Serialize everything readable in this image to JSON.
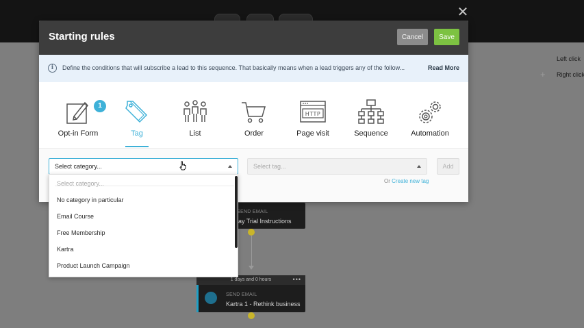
{
  "background": {
    "close_symbol": "✕",
    "right_panel": {
      "left_click": "Left click",
      "right_click": "Right click"
    },
    "flow_card_1": {
      "type_label": "SEND EMAIL",
      "title": "lay Trial Instructions"
    },
    "flow_card_2": {
      "header": "1 days and 0 hours",
      "type_label": "SEND EMAIL",
      "title": "Kartra 1 - Rethink business"
    }
  },
  "modal": {
    "title": "Starting rules",
    "cancel_label": "Cancel",
    "save_label": "Save",
    "info": {
      "text": "Define the conditions that will subscribe a lead to this sequence. That basically means when a lead triggers any of the follow...",
      "read_more": "Read More"
    },
    "triggers": [
      {
        "label": "Opt-in Form",
        "icon": "opt-in-form-icon",
        "badge": "1"
      },
      {
        "label": "Tag",
        "icon": "tag-icon",
        "active": true
      },
      {
        "label": "List",
        "icon": "list-people-icon"
      },
      {
        "label": "Order",
        "icon": "cart-icon"
      },
      {
        "label": "Page visit",
        "icon": "http-page-icon"
      },
      {
        "label": "Sequence",
        "icon": "sequence-tree-icon"
      },
      {
        "label": "Automation",
        "icon": "gears-icon"
      }
    ],
    "controls": {
      "category_value": "Select category...",
      "tag_placeholder": "Select tag...",
      "add_label": "Add",
      "create_prefix": "Or",
      "create_link": "Create new tag"
    }
  },
  "dropdown": {
    "items": [
      {
        "label": "Select category...",
        "placeholder": true
      },
      {
        "label": "No category in particular"
      },
      {
        "label": "Email Course"
      },
      {
        "label": "Free Membership"
      },
      {
        "label": "Kartra"
      },
      {
        "label": "Product Launch Campaign"
      }
    ]
  },
  "colors": {
    "accent": "#3eb1d8",
    "save": "#7dc242",
    "cancel": "#8c8c8c",
    "header": "#3d3d3d",
    "info_bg": "#e8f1fa"
  }
}
